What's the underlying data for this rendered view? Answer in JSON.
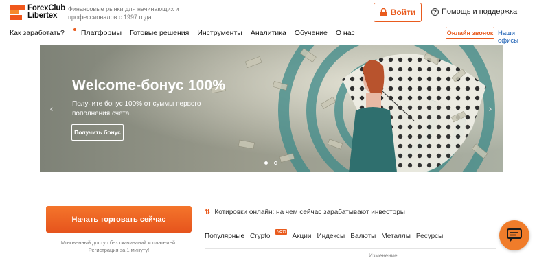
{
  "header": {
    "logo_line1": "ForexClub",
    "logo_line2": "Libertex",
    "tagline": "Финансовые рынки для начинающих и профессионалов с 1997 года",
    "login_label": "Войти",
    "help_label": "Помощь и поддержка"
  },
  "nav": {
    "items": [
      "Как заработать?",
      "Платформы",
      "Готовые решения",
      "Инструменты",
      "Аналитика",
      "Обучение",
      "О нас"
    ],
    "call_label": "Онлайн звонок",
    "offices_label": "Наши офисы"
  },
  "hero": {
    "title": "Welcome-бонус 100%",
    "subtitle": "Получите бонус 100% от суммы первого пополнения счета.",
    "cta_label": "Получить бонус",
    "slide_count": 2,
    "active_slide": 1
  },
  "trade": {
    "button_label": "Начать торговать сейчас",
    "note": "Мгновенный доступ без скачиваний и платежей. Регистрация за 1 минуту!"
  },
  "quotes": {
    "heading": "Котировки онлайн: на чем сейчас зарабатывают инвесторы",
    "tabs": [
      "Популярные",
      "Crypto",
      "Акции",
      "Индексы",
      "Валюты",
      "Металлы",
      "Ресурсы"
    ],
    "hot_badge": "HOT!",
    "column_header": "Изменение"
  },
  "colors": {
    "accent": "#e95b1e",
    "link": "#1a5fb4"
  }
}
